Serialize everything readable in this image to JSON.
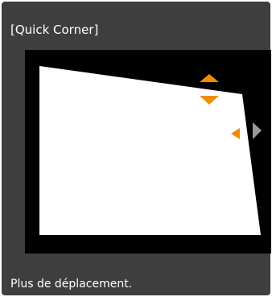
{
  "dialog": {
    "title": "[Quick Corner]",
    "status_message": "Plus de déplacement."
  },
  "icons": {
    "up": "arrow-up-icon",
    "down": "arrow-down-icon",
    "left": "arrow-left-icon",
    "right": "arrow-right-icon"
  },
  "colors": {
    "panel_background": "#3e3e3e",
    "screen_background": "#000000",
    "shape_fill": "#ffffff",
    "active_arrow": "#f08c00",
    "inactive_arrow": "#9a9a9a"
  }
}
